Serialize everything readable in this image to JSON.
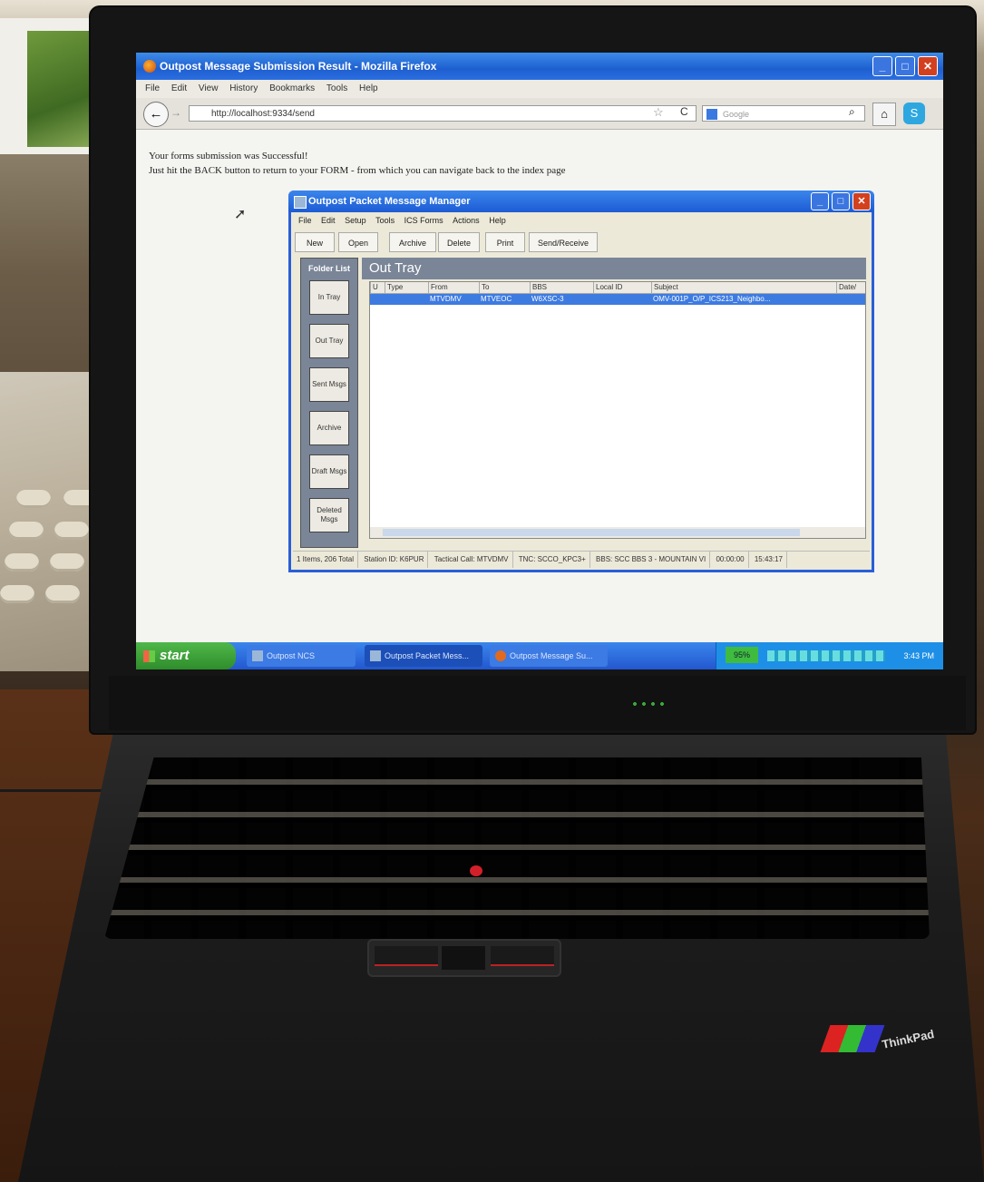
{
  "firefox": {
    "title": "Outpost Message Submission Result - Mozilla Firefox",
    "menu": [
      "File",
      "Edit",
      "View",
      "History",
      "Bookmarks",
      "Tools",
      "Help"
    ],
    "url": "http://localhost:9334/send",
    "search_placeholder": "Google",
    "content_line1": "Your forms submission was Successful!",
    "content_line2": "Just hit the BACK button to return to your FORM - from which you can navigate back to the index page"
  },
  "outpost": {
    "title": "Outpost Packet Message Manager",
    "menu": [
      "File",
      "Edit",
      "Setup",
      "Tools",
      "ICS Forms",
      "Actions",
      "Help"
    ],
    "toolbar": [
      "New",
      "Open",
      "Archive",
      "Delete",
      "Print",
      "Send/Receive"
    ],
    "folder_list_label": "Folder List",
    "folders": [
      "In Tray",
      "Out Tray",
      "Sent Msgs",
      "Archive",
      "Draft Msgs",
      "Deleted Msgs"
    ],
    "tray_title": "Out Tray",
    "columns": [
      "U",
      "Type",
      "From",
      "To",
      "BBS",
      "Local ID",
      "Subject",
      "Date/"
    ],
    "rows": [
      {
        "from": "MTVDMV",
        "to": "MTVEOC",
        "bbs": "W6XSC-3",
        "subject": "OMV-001P_O/P_ICS213_Neighbo..."
      }
    ],
    "status": [
      "1 Items, 206 Total",
      "Station ID: K6PUR",
      "Tactical Call: MTVDMV",
      "TNC: SCCO_KPC3+",
      "BBS: SCC BBS 3 - MOUNTAIN VI",
      "00:00:00",
      "15:43:17"
    ]
  },
  "taskbar": {
    "start_label": "start",
    "tasks": [
      "Outpost NCS",
      "Outpost Packet Mess...",
      "Outpost Message Su..."
    ],
    "battery": "95%",
    "clock": "3:43 PM"
  },
  "laptop": {
    "brand": "ThinkPad"
  }
}
